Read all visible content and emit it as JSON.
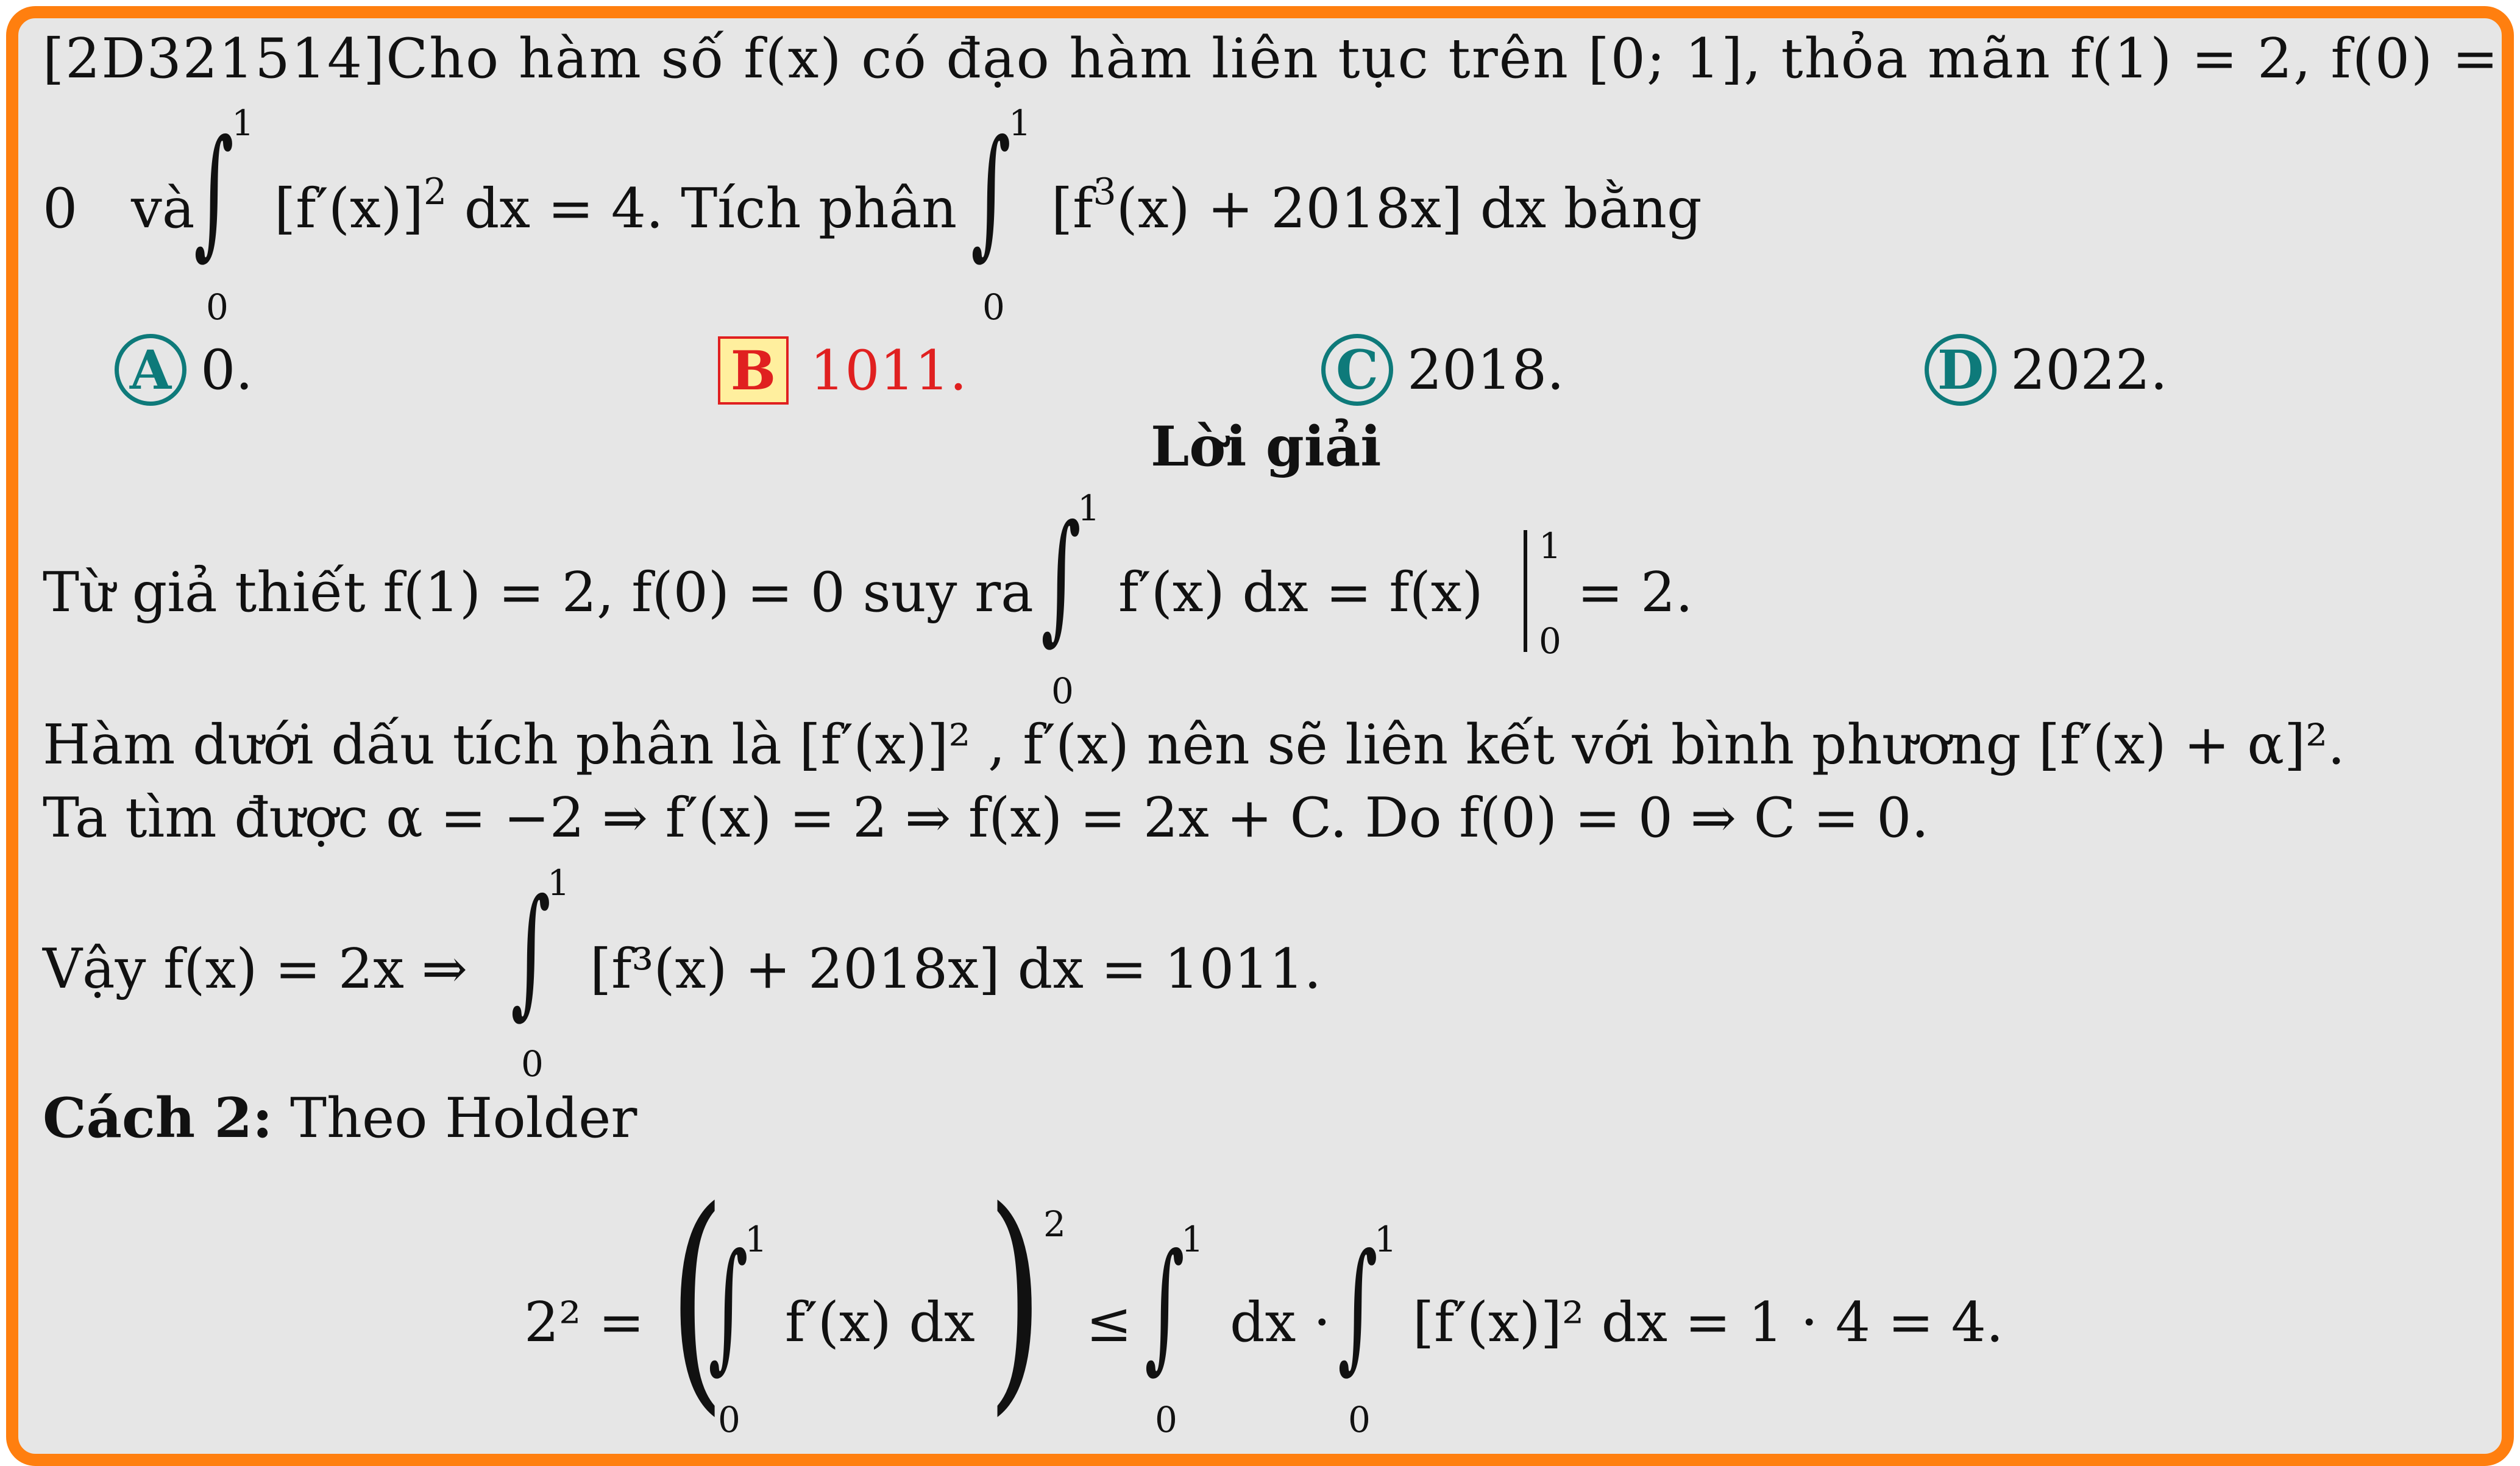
{
  "question": {
    "line1": "[2D321514]Cho hàm số f(x) có đạo hàm liên tục trên [0; 1], thỏa mãn f(1) = 2, f(0) =",
    "line2_start": "0",
    "line2_va": "và",
    "line2_expr1": "[f′(x)]",
    "line2_exp1": "2",
    "line2_mid": " dx = 4. Tích phân",
    "line2_expr2": "[f",
    "line2_exp2": "3",
    "line2_expr2b": "(x) + 2018x]  dx bằng",
    "upper": "1",
    "lower": "0"
  },
  "choices": [
    {
      "label": "A",
      "text": "0.",
      "correct": false
    },
    {
      "label": "B",
      "text": "1011.",
      "correct": true
    },
    {
      "label": "C",
      "text": "2018.",
      "correct": false
    },
    {
      "label": "D",
      "text": "2022.",
      "correct": false
    }
  ],
  "solution": {
    "heading": "Lời giải",
    "l1_a": "Từ giả thiết f(1) = 2, f(0) = 0 suy ra",
    "l1_b": "f′(x) dx = f(x)",
    "l1_c": "= 2.",
    "l2": "Hàm dưới dấu tích phân là [f′(x)]² , f′(x) nên sẽ liên kết với bình phương [f′(x) + α]².",
    "l3": "Ta tìm được α = −2 ⇒ f′(x) = 2 ⇒ f(x) = 2x + C. Do f(0) = 0 ⇒ C = 0.",
    "l4_a": "Vậy f(x) = 2x ⇒",
    "l4_b": "[f³(x) + 2018x]  dx = 1011.",
    "cach2_label": "Cách 2:",
    "cach2_text": " Theo Holder",
    "eq_lhs": "2² =",
    "eq_inner": "f′(x) dx",
    "eq_pow": "2",
    "eq_leq": "≤",
    "eq_dx": "dx ·",
    "eq_last": "[f′(x)]² dx = 1 · 4 = 4."
  },
  "colors": {
    "border": "#ff7f0f",
    "background": "#e6e6e6",
    "choice_circle": "#0e7a7a",
    "correct": "#e02020",
    "correct_fill": "#ffef9e"
  }
}
